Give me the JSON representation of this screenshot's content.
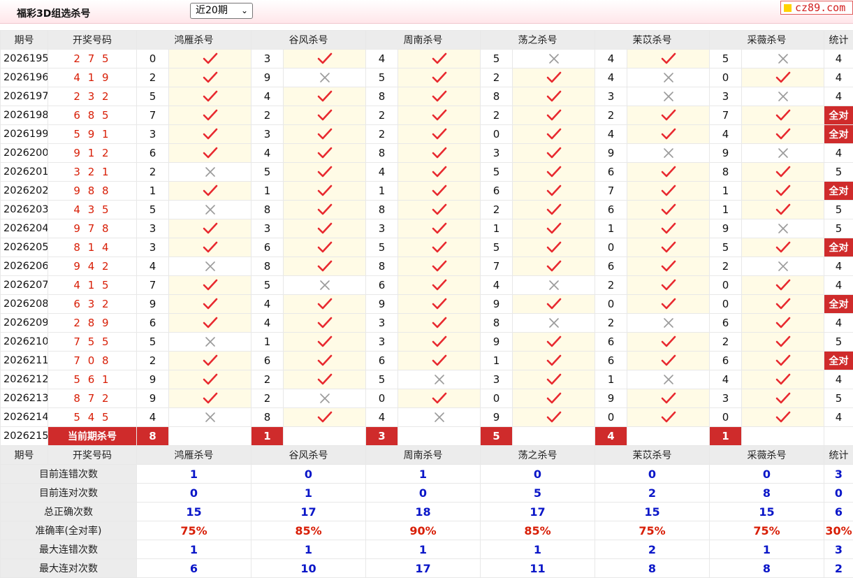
{
  "app": {
    "title": "福彩3D组选杀号",
    "period_select": "近20期",
    "logo": "cz89.com"
  },
  "colors": {
    "accent": "#cf2b2b",
    "value_blue": "#0a16c8",
    "value_red": "#d81e06",
    "hit_bg": "#fffbe6"
  },
  "headers": {
    "issue": "期号",
    "draw": "开奖号码",
    "experts": [
      "鸿雁杀号",
      "谷风杀号",
      "周南杀号",
      "荡之杀号",
      "苿苡杀号",
      "采薇杀号"
    ],
    "stat": "统计"
  },
  "rows": [
    {
      "issue": "2026195",
      "draw": "2 7 5",
      "kills": [
        {
          "n": "0",
          "ok": true
        },
        {
          "n": "3",
          "ok": true
        },
        {
          "n": "4",
          "ok": true
        },
        {
          "n": "5",
          "ok": false
        },
        {
          "n": "4",
          "ok": true
        },
        {
          "n": "5",
          "ok": false
        }
      ],
      "stat": "4"
    },
    {
      "issue": "2026196",
      "draw": "4 1 9",
      "kills": [
        {
          "n": "2",
          "ok": true
        },
        {
          "n": "9",
          "ok": false
        },
        {
          "n": "5",
          "ok": true
        },
        {
          "n": "2",
          "ok": true
        },
        {
          "n": "4",
          "ok": false
        },
        {
          "n": "0",
          "ok": true
        }
      ],
      "stat": "4"
    },
    {
      "issue": "2026197",
      "draw": "2 3 2",
      "kills": [
        {
          "n": "5",
          "ok": true
        },
        {
          "n": "4",
          "ok": true
        },
        {
          "n": "8",
          "ok": true
        },
        {
          "n": "8",
          "ok": true
        },
        {
          "n": "3",
          "ok": false
        },
        {
          "n": "3",
          "ok": false
        }
      ],
      "stat": "4"
    },
    {
      "issue": "2026198",
      "draw": "6 8 5",
      "kills": [
        {
          "n": "7",
          "ok": true
        },
        {
          "n": "2",
          "ok": true
        },
        {
          "n": "2",
          "ok": true
        },
        {
          "n": "2",
          "ok": true
        },
        {
          "n": "2",
          "ok": true
        },
        {
          "n": "7",
          "ok": true
        }
      ],
      "stat": "全对"
    },
    {
      "issue": "2026199",
      "draw": "5 9 1",
      "kills": [
        {
          "n": "3",
          "ok": true
        },
        {
          "n": "3",
          "ok": true
        },
        {
          "n": "2",
          "ok": true
        },
        {
          "n": "0",
          "ok": true
        },
        {
          "n": "4",
          "ok": true
        },
        {
          "n": "4",
          "ok": true
        }
      ],
      "stat": "全对"
    },
    {
      "issue": "2026200",
      "draw": "9 1 2",
      "kills": [
        {
          "n": "6",
          "ok": true
        },
        {
          "n": "4",
          "ok": true
        },
        {
          "n": "8",
          "ok": true
        },
        {
          "n": "3",
          "ok": true
        },
        {
          "n": "9",
          "ok": false
        },
        {
          "n": "9",
          "ok": false
        }
      ],
      "stat": "4"
    },
    {
      "issue": "2026201",
      "draw": "3 2 1",
      "kills": [
        {
          "n": "2",
          "ok": false
        },
        {
          "n": "5",
          "ok": true
        },
        {
          "n": "4",
          "ok": true
        },
        {
          "n": "5",
          "ok": true
        },
        {
          "n": "6",
          "ok": true
        },
        {
          "n": "8",
          "ok": true
        }
      ],
      "stat": "5"
    },
    {
      "issue": "2026202",
      "draw": "9 8 8",
      "kills": [
        {
          "n": "1",
          "ok": true
        },
        {
          "n": "1",
          "ok": true
        },
        {
          "n": "1",
          "ok": true
        },
        {
          "n": "6",
          "ok": true
        },
        {
          "n": "7",
          "ok": true
        },
        {
          "n": "1",
          "ok": true
        }
      ],
      "stat": "全对"
    },
    {
      "issue": "2026203",
      "draw": "4 3 5",
      "kills": [
        {
          "n": "5",
          "ok": false
        },
        {
          "n": "8",
          "ok": true
        },
        {
          "n": "8",
          "ok": true
        },
        {
          "n": "2",
          "ok": true
        },
        {
          "n": "6",
          "ok": true
        },
        {
          "n": "1",
          "ok": true
        }
      ],
      "stat": "5"
    },
    {
      "issue": "2026204",
      "draw": "9 7 8",
      "kills": [
        {
          "n": "3",
          "ok": true
        },
        {
          "n": "3",
          "ok": true
        },
        {
          "n": "3",
          "ok": true
        },
        {
          "n": "1",
          "ok": true
        },
        {
          "n": "1",
          "ok": true
        },
        {
          "n": "9",
          "ok": false
        }
      ],
      "stat": "5"
    },
    {
      "issue": "2026205",
      "draw": "8 1 4",
      "kills": [
        {
          "n": "3",
          "ok": true
        },
        {
          "n": "6",
          "ok": true
        },
        {
          "n": "5",
          "ok": true
        },
        {
          "n": "5",
          "ok": true
        },
        {
          "n": "0",
          "ok": true
        },
        {
          "n": "5",
          "ok": true
        }
      ],
      "stat": "全对"
    },
    {
      "issue": "2026206",
      "draw": "9 4 2",
      "kills": [
        {
          "n": "4",
          "ok": false
        },
        {
          "n": "8",
          "ok": true
        },
        {
          "n": "8",
          "ok": true
        },
        {
          "n": "7",
          "ok": true
        },
        {
          "n": "6",
          "ok": true
        },
        {
          "n": "2",
          "ok": false
        }
      ],
      "stat": "4"
    },
    {
      "issue": "2026207",
      "draw": "4 1 5",
      "kills": [
        {
          "n": "7",
          "ok": true
        },
        {
          "n": "5",
          "ok": false
        },
        {
          "n": "6",
          "ok": true
        },
        {
          "n": "4",
          "ok": false
        },
        {
          "n": "2",
          "ok": true
        },
        {
          "n": "0",
          "ok": true
        }
      ],
      "stat": "4"
    },
    {
      "issue": "2026208",
      "draw": "6 3 2",
      "kills": [
        {
          "n": "9",
          "ok": true
        },
        {
          "n": "4",
          "ok": true
        },
        {
          "n": "9",
          "ok": true
        },
        {
          "n": "9",
          "ok": true
        },
        {
          "n": "0",
          "ok": true
        },
        {
          "n": "0",
          "ok": true
        }
      ],
      "stat": "全对"
    },
    {
      "issue": "2026209",
      "draw": "2 8 9",
      "kills": [
        {
          "n": "6",
          "ok": true
        },
        {
          "n": "4",
          "ok": true
        },
        {
          "n": "3",
          "ok": true
        },
        {
          "n": "8",
          "ok": false
        },
        {
          "n": "2",
          "ok": false
        },
        {
          "n": "6",
          "ok": true
        }
      ],
      "stat": "4"
    },
    {
      "issue": "2026210",
      "draw": "7 5 5",
      "kills": [
        {
          "n": "5",
          "ok": false
        },
        {
          "n": "1",
          "ok": true
        },
        {
          "n": "3",
          "ok": true
        },
        {
          "n": "9",
          "ok": true
        },
        {
          "n": "6",
          "ok": true
        },
        {
          "n": "2",
          "ok": true
        }
      ],
      "stat": "5"
    },
    {
      "issue": "2026211",
      "draw": "7 0 8",
      "kills": [
        {
          "n": "2",
          "ok": true
        },
        {
          "n": "6",
          "ok": true
        },
        {
          "n": "6",
          "ok": true
        },
        {
          "n": "1",
          "ok": true
        },
        {
          "n": "6",
          "ok": true
        },
        {
          "n": "6",
          "ok": true
        }
      ],
      "stat": "全对"
    },
    {
      "issue": "2026212",
      "draw": "5 6 1",
      "kills": [
        {
          "n": "9",
          "ok": true
        },
        {
          "n": "2",
          "ok": true
        },
        {
          "n": "5",
          "ok": false
        },
        {
          "n": "3",
          "ok": true
        },
        {
          "n": "1",
          "ok": false
        },
        {
          "n": "4",
          "ok": true
        }
      ],
      "stat": "4"
    },
    {
      "issue": "2026213",
      "draw": "8 7 2",
      "kills": [
        {
          "n": "9",
          "ok": true
        },
        {
          "n": "2",
          "ok": false
        },
        {
          "n": "0",
          "ok": true
        },
        {
          "n": "0",
          "ok": true
        },
        {
          "n": "9",
          "ok": true
        },
        {
          "n": "3",
          "ok": true
        }
      ],
      "stat": "5"
    },
    {
      "issue": "2026214",
      "draw": "5 4 5",
      "kills": [
        {
          "n": "4",
          "ok": false
        },
        {
          "n": "8",
          "ok": true
        },
        {
          "n": "4",
          "ok": false
        },
        {
          "n": "9",
          "ok": true
        },
        {
          "n": "0",
          "ok": true
        },
        {
          "n": "0",
          "ok": true
        }
      ],
      "stat": "4"
    }
  ],
  "current": {
    "issue": "2026215",
    "label": "当前期杀号",
    "kills": [
      "8",
      "1",
      "3",
      "5",
      "4",
      "1"
    ]
  },
  "stats": [
    {
      "label": "目前连错次数",
      "values": [
        "1",
        "0",
        "1",
        "0",
        "0",
        "0"
      ],
      "total": "3",
      "kind": "count"
    },
    {
      "label": "目前连对次数",
      "values": [
        "0",
        "1",
        "0",
        "5",
        "2",
        "8"
      ],
      "total": "0",
      "kind": "count"
    },
    {
      "label": "总正确次数",
      "values": [
        "15",
        "17",
        "18",
        "17",
        "15",
        "15"
      ],
      "total": "6",
      "kind": "count"
    },
    {
      "label": "准确率(全对率)",
      "values": [
        "75%",
        "85%",
        "90%",
        "85%",
        "75%",
        "75%"
      ],
      "total": "30%",
      "kind": "pct"
    },
    {
      "label": "最大连错次数",
      "values": [
        "1",
        "1",
        "1",
        "1",
        "2",
        "1"
      ],
      "total": "3",
      "kind": "count"
    },
    {
      "label": "最大连对次数",
      "values": [
        "6",
        "10",
        "17",
        "11",
        "8",
        "8"
      ],
      "total": "2",
      "kind": "count"
    }
  ]
}
